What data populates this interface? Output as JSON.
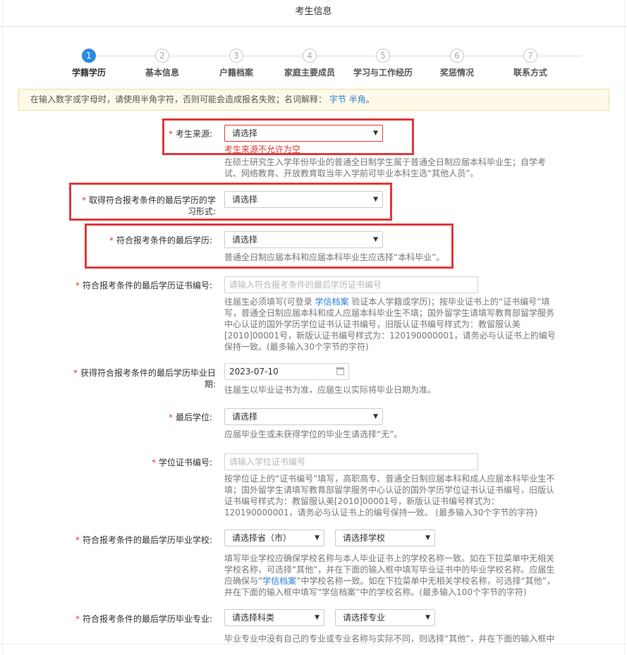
{
  "title": "考生信息",
  "steps": [
    {
      "num": "1",
      "label": "学籍学历"
    },
    {
      "num": "2",
      "label": "基本信息"
    },
    {
      "num": "3",
      "label": "户籍档案"
    },
    {
      "num": "4",
      "label": "家庭主要成员"
    },
    {
      "num": "5",
      "label": "学习与工作经历"
    },
    {
      "num": "6",
      "label": "奖惩情况"
    },
    {
      "num": "7",
      "label": "联系方式"
    }
  ],
  "notice": {
    "text": "在输入数字或字母时，请使用半角字符，否则可能会造成报名失败；名词解释：",
    "link1": "字节",
    "link2": "半角",
    "end": "。"
  },
  "required_mark": "*",
  "fields": {
    "source": {
      "label": "考生来源:",
      "value": "请选择",
      "error": "考生来源不允许为空",
      "hint": "在硕士研究生入学年份毕业的普通全日制学生属于普通全日制应届本科毕业生；自学考试、网络教育、开放教育取当年入学前可毕业本科生选“其他人员”。"
    },
    "study_form": {
      "label": "取得符合报考条件的最后学历的学习形式:",
      "value": "请选择"
    },
    "last_degree": {
      "label": "符合报考条件的最后学历:",
      "value": "请选择",
      "hint": "普通全日制应届本科和应届本科毕业生应选择“本科毕业”。"
    },
    "cert_no": {
      "label": "符合报考条件的最后学历证书编号:",
      "placeholder": "请输入符合报考条件的最后学历证书编号",
      "hint_a": "往届生必须填写(可登录 ",
      "hint_link": "学信档案",
      "hint_b": " 验证本人学籍或学历)；按毕业证书上的“证书编号”填写，普通全日制应届本科和成人应届本科毕业生不填；国外留学生请填写教育部留学服务中心认证的国外学历学位证书认证书编号，旧版认证书编号样式为：教留服认美[2010]00001号，新版认证书编号样式为：120190000001，请务必与认证书上的编号保持一致。(最多输入30个字节的字符)"
    },
    "grad_date": {
      "label": "获得符合报考条件的最后学历毕业日期:",
      "value": "2023-07-10",
      "hint": "往届生以毕业证书为准，应届生以实际将毕业日期为准。"
    },
    "degree": {
      "label": "最后学位:",
      "value": "请选择",
      "hint": "应届毕业生或未获得学位的毕业生请选择“无”。"
    },
    "degree_cert": {
      "label": "学位证书编号:",
      "placeholder": "请输入学位证书编号",
      "hint": "按学位证上的“证书编号”填写，高职高专、普通全日制应届本科和成人应届本科毕业生不填；国外留学生请填写教育部留学服务中心认证的国外学历学位证书认证书编号，旧版认证书编号样式为：教留服认美[2010]00001号，新版认证书编号样式为：120190000001，请务必与认证书上的编号保持一致。 (最多输入30个字节的字符)"
    },
    "school": {
      "label": "符合报考条件的最后学历毕业学校:",
      "province": "请选择省（市）",
      "school": "请选择学校",
      "hint_a": "填写毕业学校应确保学校名称与本人毕业证书上的学校名称一致。如在下拉菜单中无相关学校名称，可选择“其他”，并在下面的输入框中填写毕业证书中的毕业学校名称。应届生应确保与“",
      "hint_link": "学信档案",
      "hint_b": "”中学校名称一致。如在下拉菜单中无相关学校名称，可选择“其他”，并在下面的输入框中填写“学信档案”中的学校名称。(最多输入100个字节的字符)"
    },
    "major": {
      "label": "符合报考条件的最后学历毕业专业:",
      "category": "请选择科类",
      "major": "请选择专业",
      "hint": "毕业专业中没有自己的专业或专业名称与实际不同，则选择“其他”，并在下面的输入框中"
    }
  },
  "icons": {
    "dropdown": "▼",
    "calendar": "calendar-icon"
  },
  "colors": {
    "accent": "#2a8be0",
    "error": "#e03b3b",
    "link": "#2a7fd4"
  }
}
